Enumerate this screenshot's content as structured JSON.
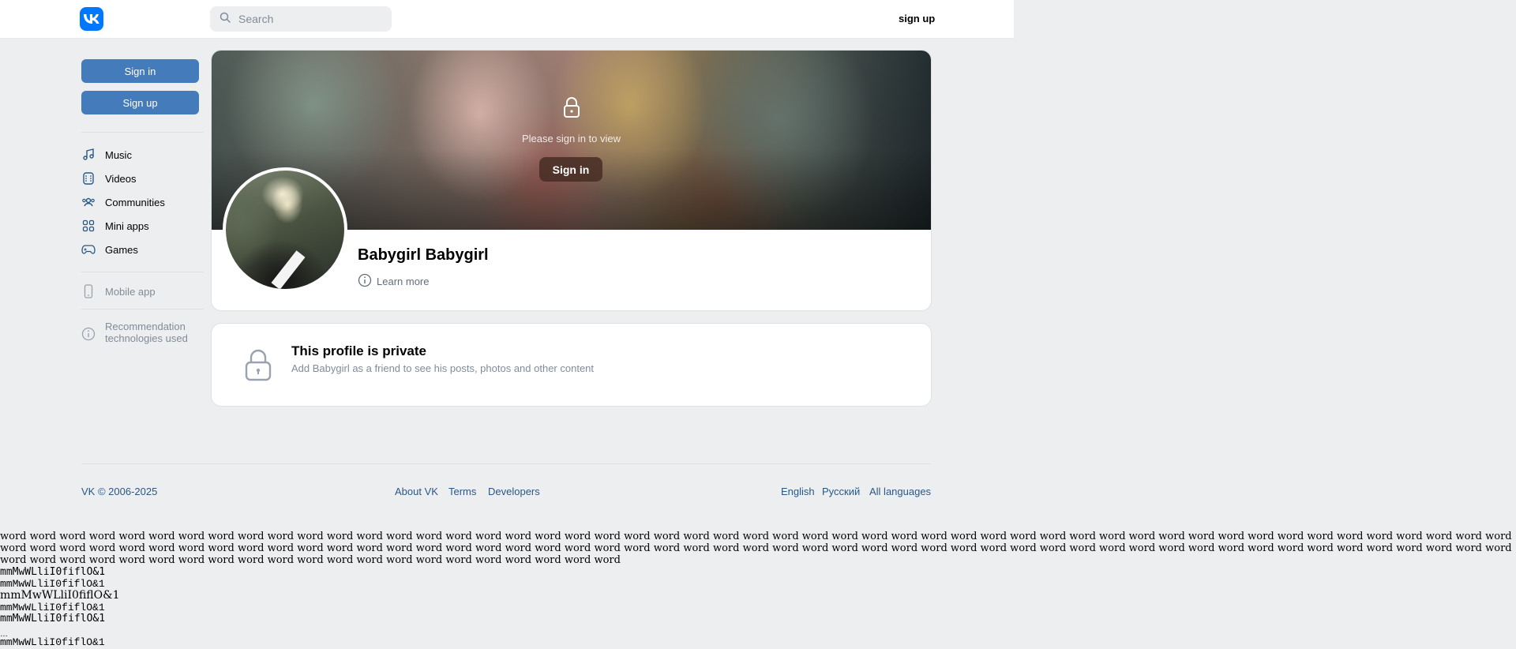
{
  "header": {
    "search_placeholder": "Search",
    "signup_label": "sign up"
  },
  "sidebar": {
    "signin_label": "Sign in",
    "signup_label": "Sign up",
    "items": [
      {
        "label": "Music",
        "icon": "music-icon"
      },
      {
        "label": "Videos",
        "icon": "video-icon"
      },
      {
        "label": "Communities",
        "icon": "communities-icon"
      },
      {
        "label": "Mini apps",
        "icon": "mini-apps-icon"
      },
      {
        "label": "Games",
        "icon": "gamepad-icon"
      }
    ],
    "mobile_app_label": "Mobile app",
    "recommendation_line1": "Recommendation",
    "recommendation_line2": "technologies used"
  },
  "profile": {
    "cover_signin_text": "Please sign in to view",
    "cover_signin_button": "Sign in",
    "name": "Babygirl Babygirl",
    "learn_more": "Learn more"
  },
  "private": {
    "title": "This profile is private",
    "subtitle": "Add Babygirl as a friend to see his posts, photos and other content"
  },
  "footer": {
    "copyright": "VK © 2006-2025",
    "about": "About VK",
    "terms": "Terms",
    "developers": "Developers",
    "english": "English",
    "russian": "Русский",
    "all_languages": "All languages"
  },
  "debug": {
    "words": "word word word word word word word word word word word word word word word word word word word word word word word word word word word word word word word word word word word word word word word word word word word word word word word word word word word word word word word word word word word word word word word word word word word word word word word word word word word word word word word word word word word word word word word word word word word word word word word word word word word word word word word word word word word word word word word word word word word word word word word word word word word",
    "samples": [
      "mmMwWLliI0fiflO&1",
      "mmMwWLliI0fiflO&1",
      "mmMwWLliI0fiflO&1",
      "mmMwWLliI0fiflO&1",
      "mmMwWLliI0fiflO&1",
      "mmMwWLliI0fiflO&1"
    ],
    "dots": "…"
  },
  "colors": {
    "accent": "#447bba",
    "brand": "#0077ff",
    "background": "#edeef0",
    "link": "#2a5885"
  }
}
